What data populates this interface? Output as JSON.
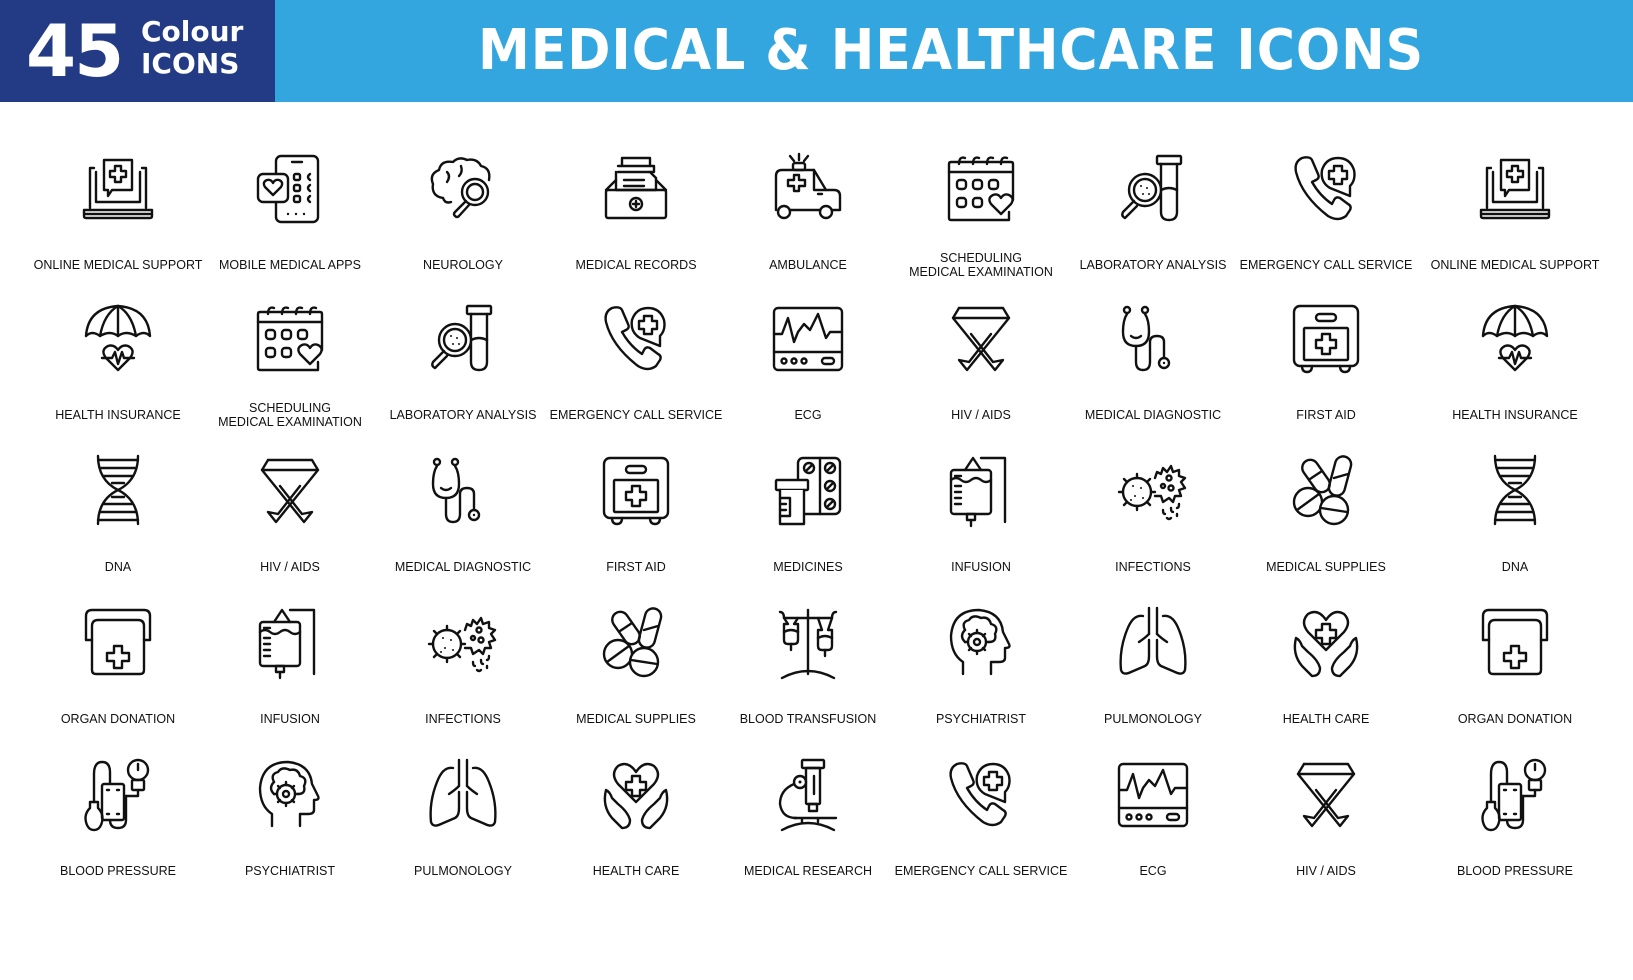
{
  "banner": {
    "count": "45",
    "badge_line1": "Colour",
    "badge_line2": "ICONS",
    "title": "MEDICAL & HEALTHCARE ICONS",
    "colors": {
      "badge_bg": "#233a85",
      "banner_bg": "#33a6e0",
      "text": "#ffffff",
      "icon_stroke": "#111111"
    }
  },
  "grid": {
    "rows": 5,
    "columns": 9,
    "items": [
      {
        "icon": "laptop-medical-chat-icon",
        "label": "ONLINE MEDICAL SUPPORT"
      },
      {
        "icon": "phone-heart-app-icon",
        "label": "MOBILE MEDICAL APPS"
      },
      {
        "icon": "brain-magnifier-icon",
        "label": "NEUROLOGY"
      },
      {
        "icon": "records-tray-icon",
        "label": "MEDICAL RECORDS"
      },
      {
        "icon": "ambulance-icon",
        "label": "AMBULANCE"
      },
      {
        "icon": "calendar-heart-icon",
        "label": "SCHEDULING\nMEDICAL EXAMINATION"
      },
      {
        "icon": "test-tube-magnifier-icon",
        "label": "LABORATORY ANALYSIS"
      },
      {
        "icon": "phone-cross-bubble-icon",
        "label": "EMERGENCY CALL SERVICE"
      },
      {
        "icon": "laptop-medical-chat-icon",
        "label": "ONLINE MEDICAL SUPPORT"
      },
      {
        "icon": "umbrella-heart-icon",
        "label": "HEALTH INSURANCE"
      },
      {
        "icon": "calendar-heart-icon",
        "label": "SCHEDULING\nMEDICAL EXAMINATION"
      },
      {
        "icon": "test-tube-magnifier-icon",
        "label": "LABORATORY ANALYSIS"
      },
      {
        "icon": "phone-cross-bubble-icon",
        "label": "EMERGENCY CALL SERVICE"
      },
      {
        "icon": "ecg-monitor-icon",
        "label": "ECG"
      },
      {
        "icon": "awareness-ribbon-icon",
        "label": "HIV / AIDS"
      },
      {
        "icon": "stethoscope-icon",
        "label": "MEDICAL DIAGNOSTIC"
      },
      {
        "icon": "first-aid-kit-icon",
        "label": "FIRST AID"
      },
      {
        "icon": "umbrella-heart-icon",
        "label": "HEALTH INSURANCE"
      },
      {
        "icon": "dna-icon",
        "label": "DNA"
      },
      {
        "icon": "awareness-ribbon-icon",
        "label": "HIV / AIDS"
      },
      {
        "icon": "stethoscope-icon",
        "label": "MEDICAL DIAGNOSTIC"
      },
      {
        "icon": "first-aid-kit-icon",
        "label": "FIRST AID"
      },
      {
        "icon": "pill-bottle-blister-icon",
        "label": "MEDICINES"
      },
      {
        "icon": "iv-bag-icon",
        "label": "INFUSION"
      },
      {
        "icon": "virus-bacteria-icon",
        "label": "INFECTIONS"
      },
      {
        "icon": "pills-capsules-icon",
        "label": "MEDICAL SUPPLIES"
      },
      {
        "icon": "dna-icon",
        "label": "DNA"
      },
      {
        "icon": "organ-cooler-icon",
        "label": "ORGAN DONATION"
      },
      {
        "icon": "iv-bag-icon",
        "label": "INFUSION"
      },
      {
        "icon": "virus-bacteria-icon",
        "label": "INFECTIONS"
      },
      {
        "icon": "pills-capsules-icon",
        "label": "MEDICAL SUPPLIES"
      },
      {
        "icon": "iv-stand-icon",
        "label": "BLOOD TRANSFUSION"
      },
      {
        "icon": "head-gear-icon",
        "label": "PSYCHIATRIST"
      },
      {
        "icon": "lungs-icon",
        "label": "PULMONOLOGY"
      },
      {
        "icon": "hands-heart-icon",
        "label": "HEALTH CARE"
      },
      {
        "icon": "organ-cooler-icon",
        "label": "ORGAN DONATION"
      },
      {
        "icon": "blood-pressure-icon",
        "label": "BLOOD PRESSURE"
      },
      {
        "icon": "head-gear-icon",
        "label": "PSYCHIATRIST"
      },
      {
        "icon": "lungs-icon",
        "label": "PULMONOLOGY"
      },
      {
        "icon": "hands-heart-icon",
        "label": "HEALTH CARE"
      },
      {
        "icon": "microscope-icon",
        "label": "MEDICAL RESEARCH"
      },
      {
        "icon": "phone-cross-bubble-icon",
        "label": "EMERGENCY CALL SERVICE"
      },
      {
        "icon": "ecg-monitor-icon",
        "label": "ECG"
      },
      {
        "icon": "awareness-ribbon-icon",
        "label": "HIV / AIDS"
      },
      {
        "icon": "blood-pressure-icon",
        "label": "BLOOD PRESSURE"
      }
    ]
  }
}
